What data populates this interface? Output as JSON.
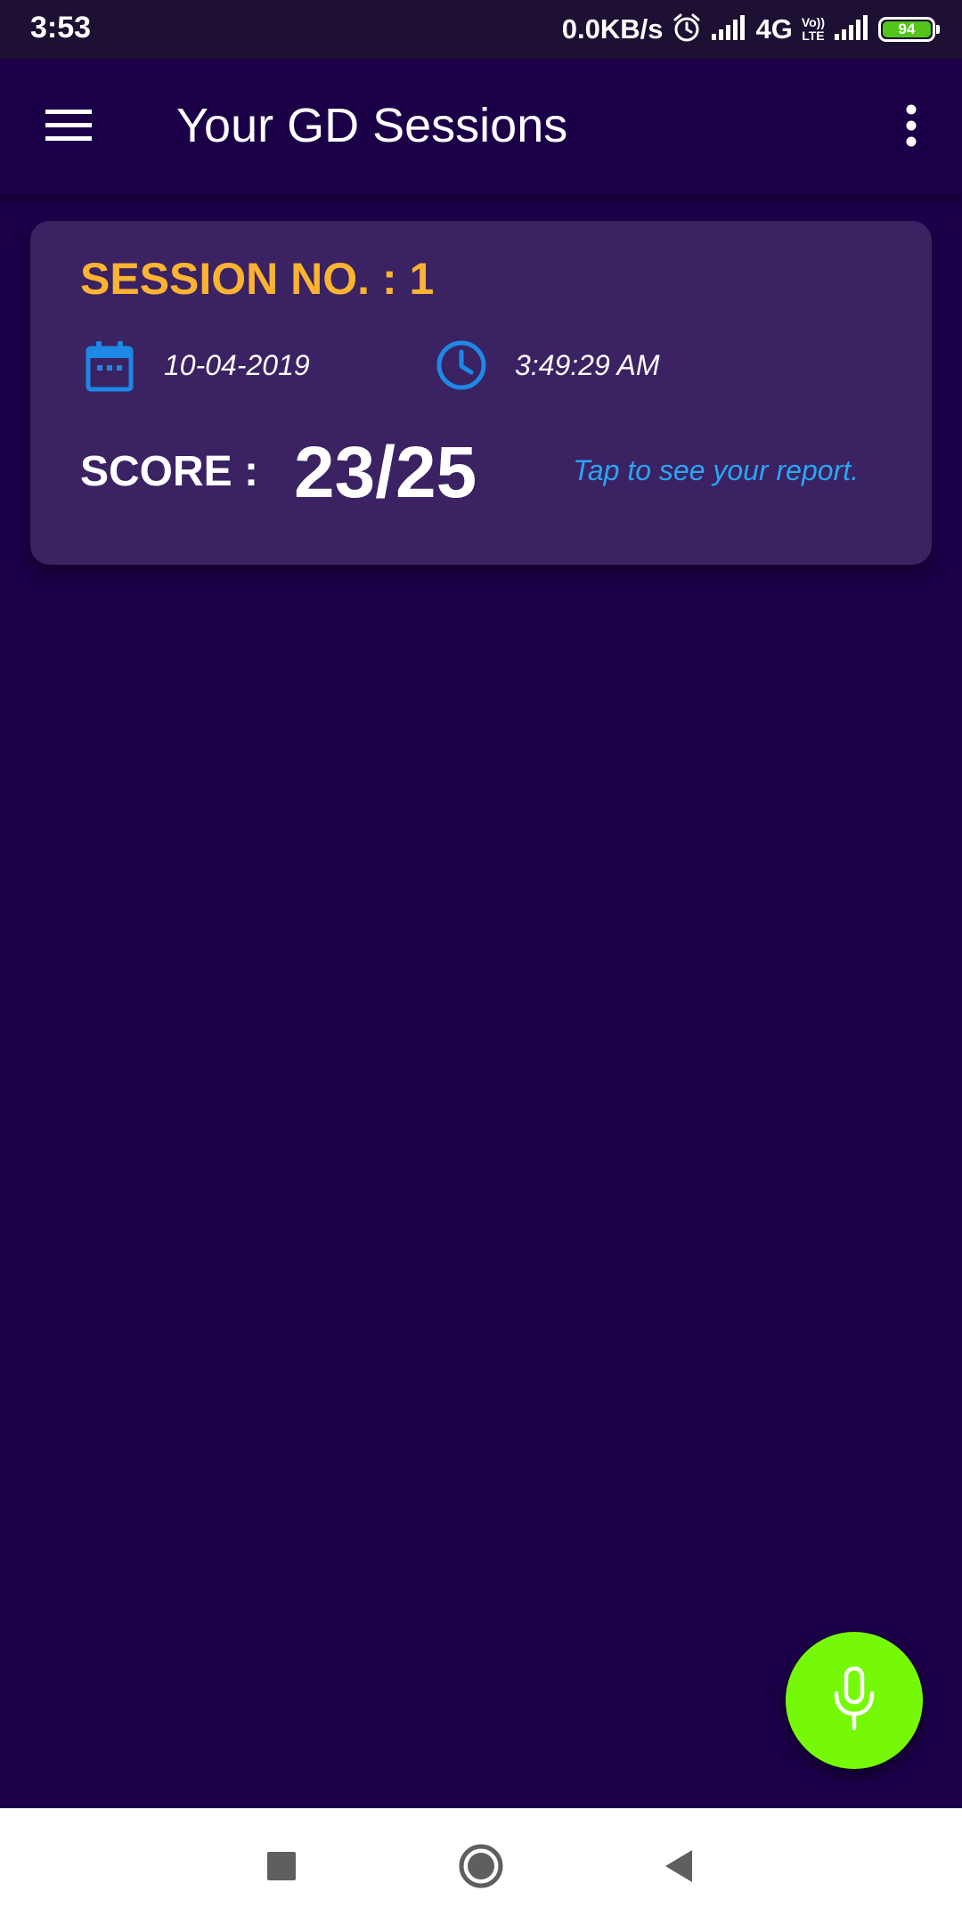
{
  "status_bar": {
    "time": "3:53",
    "network_speed": "0.0KB/s",
    "network_type": "4G",
    "volte_line1": "Vo))",
    "volte_line2": "LTE",
    "battery_level": "94",
    "icons": [
      "alarm-icon",
      "signal-icon",
      "volte-icon",
      "signal-icon",
      "battery-icon"
    ]
  },
  "app_bar": {
    "title": "Your GD Sessions",
    "menu_icon": "hamburger-menu-icon",
    "overflow_icon": "more-vert-icon"
  },
  "sessions": [
    {
      "title": "SESSION NO. : 1",
      "date": "10-04-2019",
      "time": "3:49:29 AM",
      "score_label": "SCORE :",
      "score": "23/25",
      "report_link": "Tap to see your report.",
      "date_icon": "calendar-icon",
      "time_icon": "clock-icon"
    }
  ],
  "fab": {
    "icon": "microphone-icon"
  },
  "navigation_bar": {
    "items": [
      "recents-icon",
      "home-icon",
      "back-icon"
    ]
  },
  "colors": {
    "background": "#1b0048",
    "card": "#3a2263",
    "session_title": "#fbb331",
    "link": "#2ba6f0",
    "icon_blue": "#1e88e5",
    "fab": "#76f909",
    "battery": "#52c41a"
  }
}
